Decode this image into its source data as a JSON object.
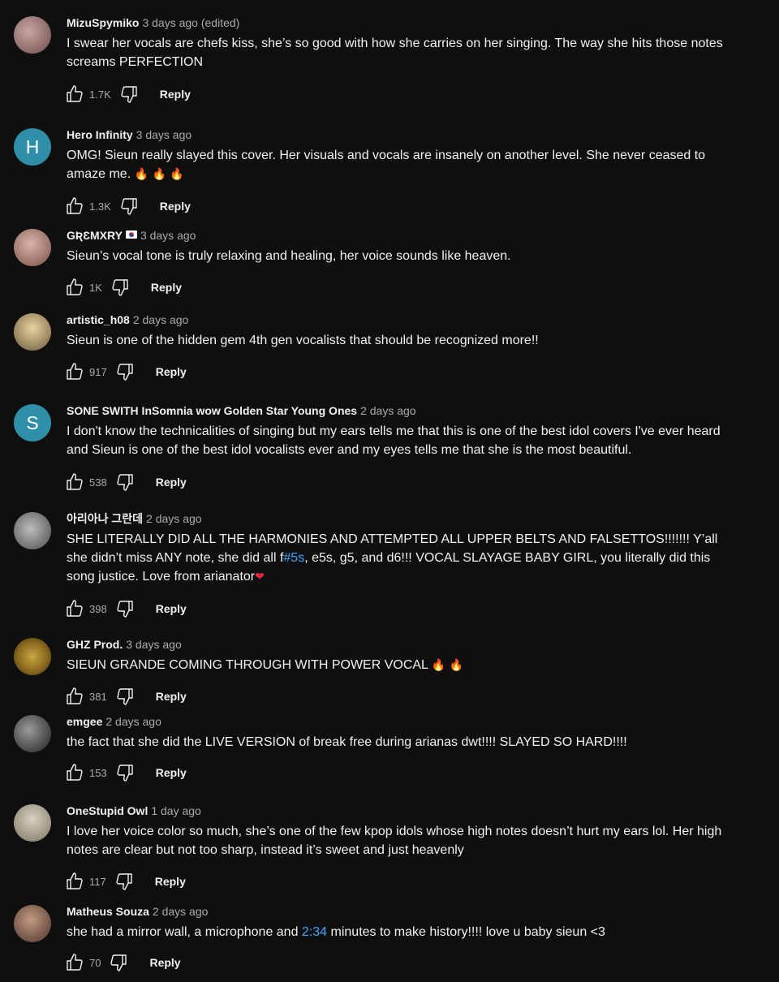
{
  "comments": [
    {
      "author": "MizuSpymiko",
      "time": "3 days ago (edited)",
      "avatar": {
        "type": "image",
        "colors": [
          "#c9a6a6",
          "#6b4a4a"
        ]
      },
      "text": "I swear her vocals are chefs kiss, she’s so good with how she carries on her singing. The way she hits those notes screams PERFECTION",
      "likes": "1.7K",
      "reply_label": "Reply"
    },
    {
      "author": "Hero Infinity",
      "time": "3 days ago",
      "avatar": {
        "type": "letter",
        "letter": "H",
        "color": "#2f8fa8"
      },
      "text": "OMG! Sieun really slayed this cover. Her visuals and vocals are insanely on another level. She never ceased to amaze me.",
      "emoji": "🔥 🔥 🔥",
      "likes": "1.3K",
      "reply_label": "Reply"
    },
    {
      "author": "GƦƐMXRY",
      "time": "3 days ago",
      "avatar": {
        "type": "image",
        "colors": [
          "#d9b3a8",
          "#7a5048"
        ]
      },
      "text": "Sieun’s vocal tone is truly relaxing and healing, her voice sounds like heaven.",
      "likes": "1K",
      "reply_label": "Reply"
    },
    {
      "author": "artistic_h08",
      "time": "2 days ago",
      "avatar": {
        "type": "image",
        "colors": [
          "#e6d3a0",
          "#6e5a3a"
        ]
      },
      "text": "Sieun is one of the hidden gem 4th gen vocalists that should be recognized more!!",
      "likes": "917",
      "reply_label": "Reply"
    },
    {
      "author": "SONE SWITH InSomnia wow Golden Star Young Ones",
      "time": "2 days ago",
      "avatar": {
        "type": "letter",
        "letter": "S",
        "color": "#2f8fa8"
      },
      "text": "I don't know the technicalities of singing but my ears tells me that this is one of the best idol covers I've ever heard and Sieun is one of the best idol vocalists ever and my eyes tells me that she is the most beautiful.",
      "likes": "538",
      "reply_label": "Reply"
    },
    {
      "author": "아리아나 그란데",
      "time": "2 days ago",
      "avatar": {
        "type": "image",
        "colors": [
          "#bdbdbd",
          "#4a4a4a"
        ]
      },
      "text_pre": "SHE LITERALLY DID ALL THE HARMONIES AND ATTEMPTED ALL UPPER BELTS AND FALSETTOS!!!!!!! Y’all she didn’t miss ANY note, she did all f",
      "text_link": "#5s",
      "text_post": ", e5s, g5, and d6!!! VOCAL SLAYAGE BABY GIRL, you literally did this song justice. Love from arianator",
      "emoji": "❤",
      "likes": "398",
      "reply_label": "Reply"
    },
    {
      "author": "GHZ Prod.",
      "time": "3 days ago",
      "avatar": {
        "type": "image",
        "colors": [
          "#c9a640",
          "#5a4210"
        ]
      },
      "text": "SIEUN GRANDE COMING THROUGH WITH POWER VOCAL",
      "emoji": "🔥 🔥",
      "likes": "381",
      "reply_label": "Reply"
    },
    {
      "author": "emgee",
      "time": "2 days ago",
      "avatar": {
        "type": "image",
        "colors": [
          "#9a9a9a",
          "#1e1e1e"
        ]
      },
      "text": "the fact that she did the LIVE VERSION of break free during arianas dwt!!!! SLAYED SO HARD!!!!",
      "likes": "153",
      "reply_label": "Reply"
    },
    {
      "author": "OneStupid Owl",
      "time": "1 day ago",
      "avatar": {
        "type": "image",
        "colors": [
          "#d8d2c4",
          "#7c7462"
        ]
      },
      "text": "I love her voice color so much, she’s one of the few kpop idols whose high notes doesn’t hurt my ears lol. Her high notes are clear but not too sharp, instead it’s sweet and just heavenly",
      "likes": "117",
      "reply_label": "Reply"
    },
    {
      "author": "Matheus Souza",
      "time": "2 days ago",
      "avatar": {
        "type": "image",
        "colors": [
          "#c49a84",
          "#4a3328"
        ]
      },
      "text_pre": "she had a mirror wall, a microphone and ",
      "text_link": "2:34",
      "text_post": " minutes to make history!!!! love u baby sieun <3",
      "likes": "70",
      "reply_label": "Reply"
    }
  ]
}
